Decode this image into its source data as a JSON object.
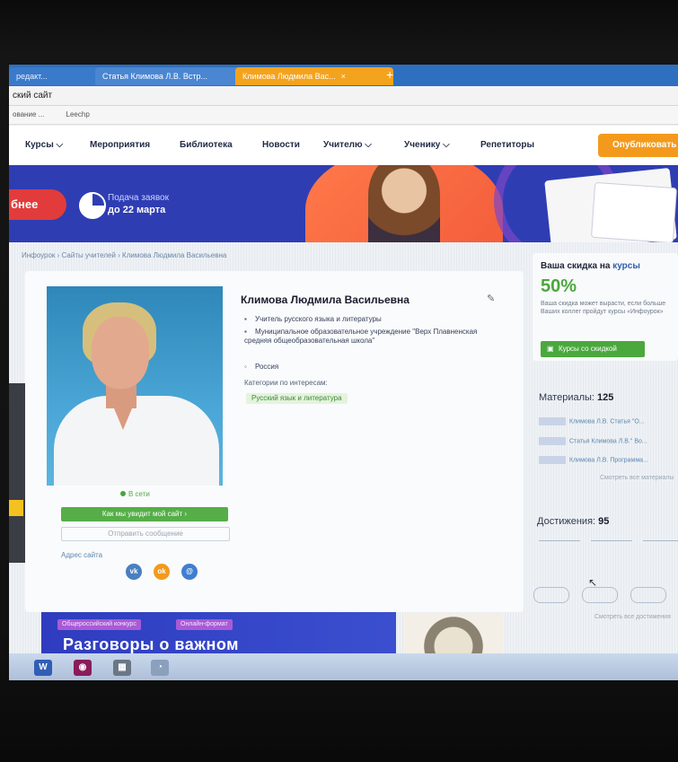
{
  "browser": {
    "tabs": [
      {
        "label": "редакт..."
      },
      {
        "label": "Статья Климова Л.В. Встр..."
      },
      {
        "label": "Климова Людмила Вас...",
        "close": "×"
      }
    ],
    "new_tab": "+",
    "address": "ский сайт",
    "bookmarks": [
      "ование ...",
      "Leechp"
    ]
  },
  "site_nav": {
    "items": [
      "Курсы ⌵",
      "Мероприятия",
      "Библиотека",
      "Новости",
      "Учителю ⌵",
      "Ученику ⌵",
      "Репетиторы"
    ],
    "publish_button": "Опубликовать"
  },
  "banner": {
    "button": "бнее",
    "line1": "Подача заявок",
    "line2": "до 22 марта"
  },
  "breadcrumbs": "Инфоурок › Сайты учителей › Климова Людмила Васильевна",
  "profile": {
    "name": "Климова Людмила Васильевна",
    "position": "Учитель русского языка и литературы",
    "organization": "Муниципальное образовательное учреждение \"Верх Плавненская средняя общеобразовательная школа\"",
    "country": "Россия",
    "categories_label": "Категории по интересам:",
    "category": "Русский язык и литература",
    "status": "В сети",
    "site_button": "Как мы увидит мой сайт ›",
    "message_button": "Отправить сообщение",
    "address_label": "Адрес сайта",
    "social": {
      "vk": "vk",
      "ok": "ok",
      "mail": "@"
    }
  },
  "sidebar": {
    "discount_title_prefix": "Ваша скидка на",
    "discount_title_link": "курсы",
    "discount_percent": "50%",
    "discount_text": "Ваша скидка может вырасти, если больше Ваших коллег пройдут курсы «Инфоурок»",
    "discount_button": "Курсы со скидкой",
    "materials_label": "Материалы:",
    "materials_count": "125",
    "materials": [
      "Климова Л.В. Статья \"О...",
      "Статья Климова Л.В.\" Во...",
      "Климова Л.В. Программа..."
    ],
    "materials_more": "Смотреть все материалы",
    "achievements_label": "Достижения:",
    "achievements_count": "95",
    "achievements_more": "Смотреть все достижения"
  },
  "bottom_banner": {
    "tag1": "Общероссийский конкурс",
    "tag2": "Онлайн-формат",
    "title": "Разговоры о важном"
  },
  "taskbar": {
    "items": [
      "word-icon",
      "app-icon",
      "calc-icon",
      "network-icon"
    ]
  }
}
